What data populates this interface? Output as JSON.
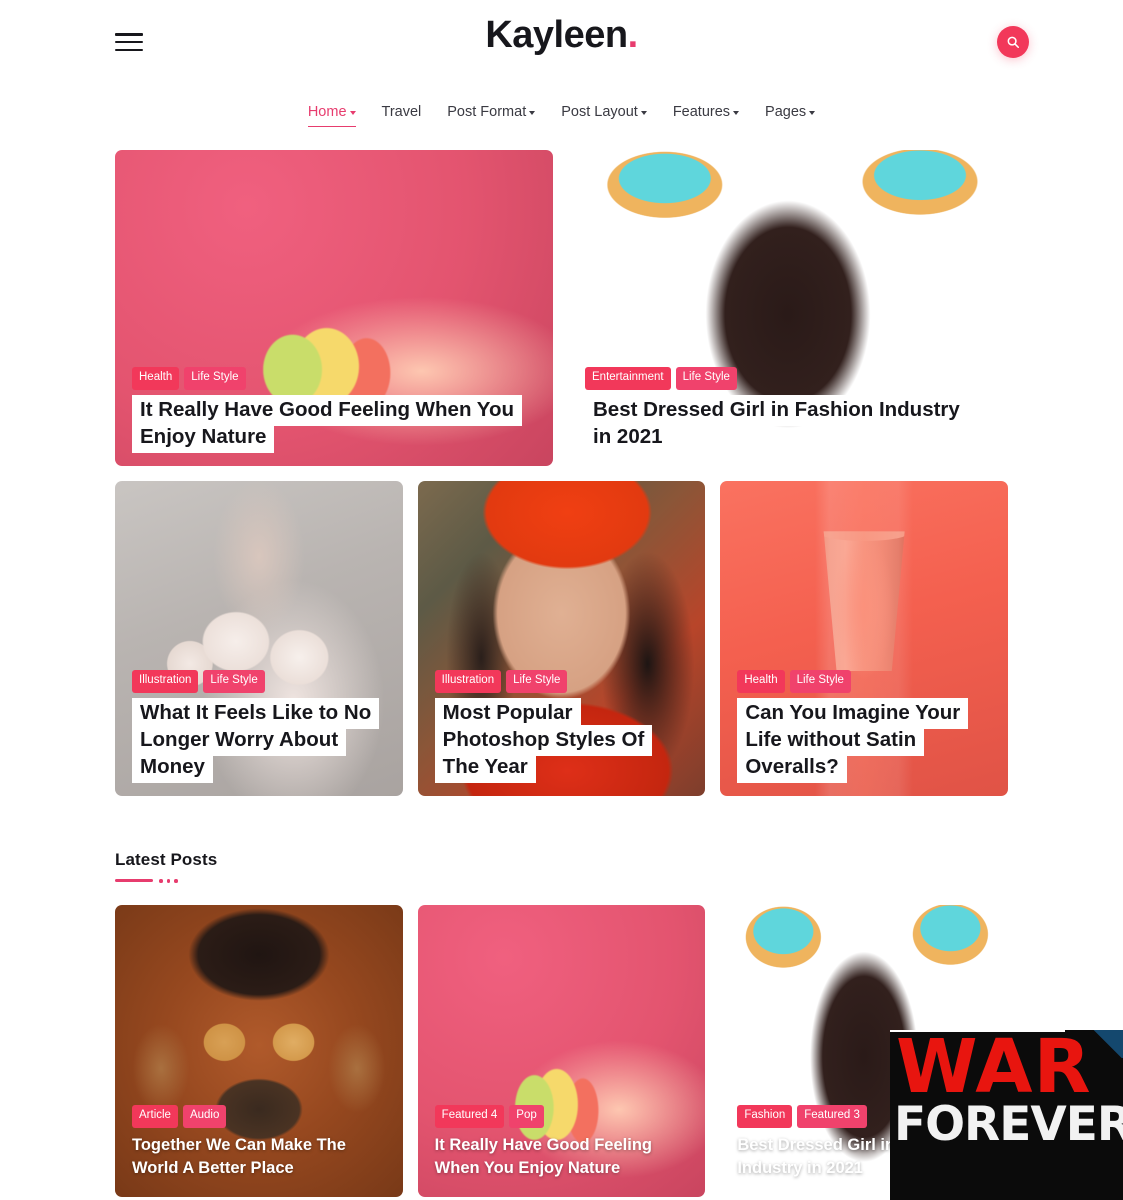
{
  "header": {
    "brand_name": "Kayleen",
    "brand_dot": ".",
    "menu_icon": "hamburger-icon",
    "search_icon": "search-icon",
    "accent_color": "#e73c6e",
    "tag_color": "#f2385a"
  },
  "nav": {
    "items": [
      {
        "label": "Home",
        "has_dropdown": true,
        "active": true
      },
      {
        "label": "Travel",
        "has_dropdown": false,
        "active": false
      },
      {
        "label": "Post Format",
        "has_dropdown": true,
        "active": false
      },
      {
        "label": "Post Layout",
        "has_dropdown": true,
        "active": false
      },
      {
        "label": "Features",
        "has_dropdown": true,
        "active": false
      },
      {
        "label": "Pages",
        "has_dropdown": true,
        "active": false
      }
    ]
  },
  "featured": {
    "top_row": [
      {
        "tags": [
          "Health",
          "Life Style"
        ],
        "title": "It Really Have Good Feeling When You Enjoy Nature",
        "image_alt": "hand-holding-candy-slices-pink-background"
      },
      {
        "tags": [
          "Entertainment",
          "Life Style"
        ],
        "title": "Best Dressed Girl in Fashion Industry in 2021",
        "image_alt": "woman-holding-blue-frosted-donuts"
      }
    ],
    "mid_row": [
      {
        "tags": [
          "Illustration",
          "Life Style"
        ],
        "title": "What It Feels Like to No Longer Worry About Money",
        "image_alt": "woman-with-flowers-blindfold"
      },
      {
        "tags": [
          "Illustration",
          "Life Style"
        ],
        "title": "Most Popular Photoshop Styles Of The Year",
        "image_alt": "woman-in-red-beanie-care-hat"
      },
      {
        "tags": [
          "Health",
          "Life Style"
        ],
        "title": "Can You Imagine Your Life without Satin Overalls?",
        "image_alt": "coral-paper-cup-on-pink-background"
      }
    ]
  },
  "latest": {
    "heading": "Latest Posts",
    "posts": [
      {
        "tags": [
          "Article",
          "Audio"
        ],
        "title": "Together We Can Make The World A Better Place",
        "image_alt": "man-with-goggles-and-mask-orange-background"
      },
      {
        "tags": [
          "Featured 4",
          "Pop"
        ],
        "title": "It Really Have Good Feeling When You Enjoy Nature",
        "image_alt": "hand-holding-candy-slices-pink-background"
      },
      {
        "tags": [
          "Fashion",
          "Featured 3"
        ],
        "title": "Best Dressed Girl in Fashion Industry in 2021",
        "image_alt": "woman-holding-blue-frosted-donuts"
      }
    ]
  },
  "ad_overlay": {
    "line1": "WAR",
    "line2": "FOREVER",
    "line1_color": "#e8150f",
    "line2_color": "#f2f2f2",
    "background": "#0b0b0b"
  }
}
